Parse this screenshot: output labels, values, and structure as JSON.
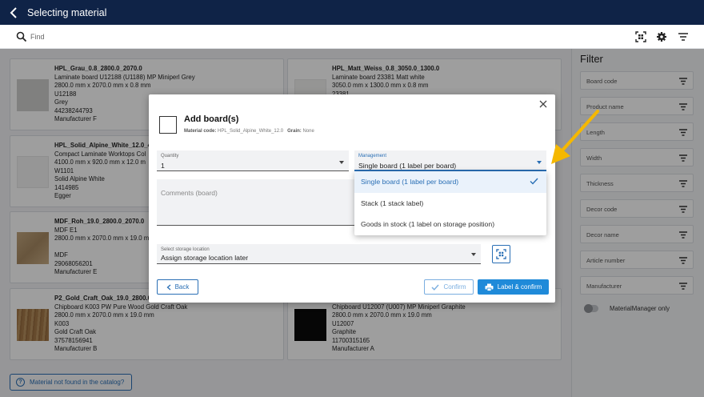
{
  "header": {
    "title": "Selecting material"
  },
  "search": {
    "placeholder": "Find"
  },
  "cards": [
    {
      "name": "HPL_Grau_0.8_2800.0_2070.0",
      "lines": [
        "Laminate board U12188 (U1188) MP Miniperl Grey",
        "2800.0 mm x 2070.0 mm x 0.8 mm",
        "U12188",
        "Grey",
        "44238244793",
        "Manufacturer F"
      ],
      "swatch": "#cfcfcd"
    },
    {
      "name": "HPL_Matt_Weiss_0.8_3050.0_1300.0",
      "lines": [
        "Laminate board 23381 Matt white",
        "3050.0 mm x 1300.0 mm x 0.8 mm",
        "23381"
      ],
      "swatch": "#f1f1ef"
    },
    {
      "name": "HPL_Solid_Alpine_White_12.0_4",
      "lines": [
        "Compact Laminate Worktops Col",
        "4100.0 mm x 920.0 mm x 12.0 m",
        "W1101",
        "Solid Alpine White",
        "1414985",
        "Egger"
      ],
      "swatch": "#f3f3f2"
    },
    {
      "name": "MDF_Roh_19.0_2800.0_2070.0",
      "lines": [
        "MDF E1",
        "2800.0 mm x 2070.0 mm x 19.0 mm",
        "",
        "MDF",
        "29068056201",
        "Manufacturer E"
      ],
      "swatch": "#b79a72"
    },
    {
      "name": "P2_Gold_Craft_Oak_19.0_2800.0",
      "lines": [
        "Chipboard K003 PW Pure Wood Gold Craft Oak",
        "2800.0 mm x 2070.0 mm x 19.0 mm",
        "K003",
        "Gold Craft Oak",
        "37578156941",
        "Manufacturer B"
      ],
      "swatch": "#a57a4a"
    },
    {
      "name": "",
      "lines": [
        "Chipboard U12007 (U007) MP Miniperl Graphite",
        "2800.0 mm x 2070.0 mm x 19.0 mm",
        "U12007",
        "Graphite",
        "11700315165",
        "Manufacturer A"
      ],
      "swatch": "#0a0a0a"
    }
  ],
  "not_found": {
    "label": "Material not found in the catalog?"
  },
  "filter": {
    "title": "Filter",
    "fields": [
      "Board code",
      "Product name",
      "Length",
      "Width",
      "Thickness",
      "Decor code",
      "Decor name",
      "Article number",
      "Manufacturer"
    ],
    "toggle_label": "MaterialManager only"
  },
  "modal": {
    "title": "Add board(s)",
    "material_code_label": "Material code:",
    "material_code": "HPL_Solid_Alpine_White_12.0",
    "grain_label": "Grain:",
    "grain": "None",
    "quantity_label": "Quantity",
    "quantity_value": "1",
    "management_label": "Management",
    "management_value": "Single board (1 label per board)",
    "comments_label": "Comments (board)",
    "storage_label": "Select storage location",
    "storage_value": "Assign storage location later",
    "back_label": "Back",
    "confirm_label": "Confirm",
    "label_confirm_label": "Label & confirm"
  },
  "dropdown": {
    "options": [
      "Single board (1 label per board)",
      "Stack (1 stack label)",
      "Goods in stock (1 label on storage position)"
    ],
    "selected_index": 0
  },
  "colors": {
    "header_bg": "#0f2347",
    "accent": "#2a6fb5",
    "primary_button": "#1f8ad9",
    "annotation_arrow": "#f5b800"
  }
}
